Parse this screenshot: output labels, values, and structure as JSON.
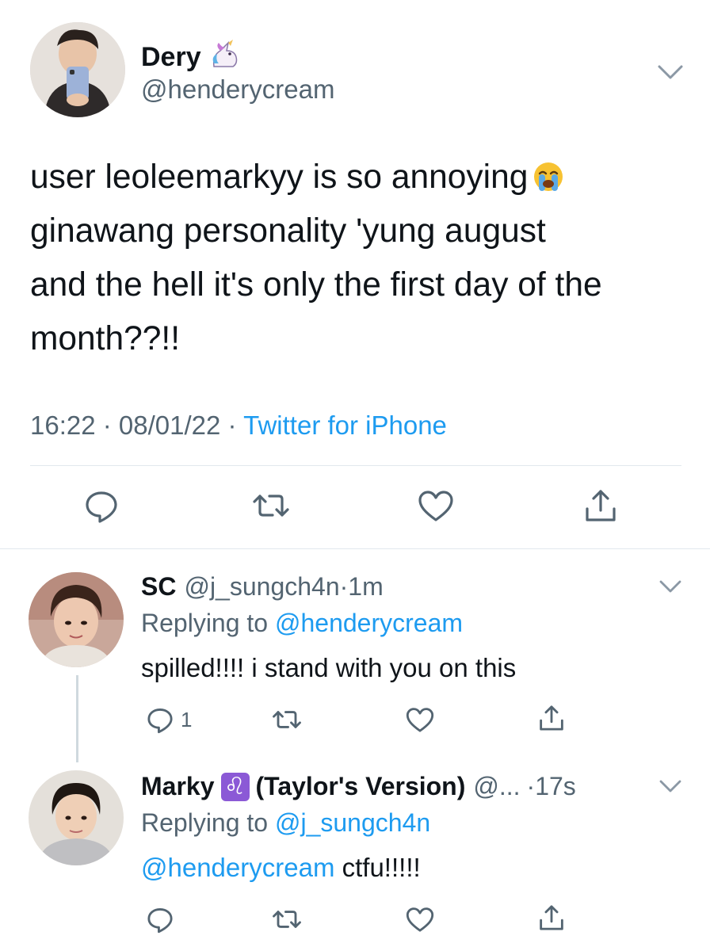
{
  "main_tweet": {
    "display_name": "Dery",
    "name_emoji": "unicorn-emoji",
    "handle": "@henderycream",
    "text_lines": [
      "user leoleemarkyy is so annoying",
      "ginawang personality 'yung august",
      "and the hell it's only the first day of the",
      "month??!!"
    ],
    "text_emoji": "loudly-crying-face-emoji",
    "time": "16:22",
    "date": "08/01/22",
    "source": "Twitter for iPhone",
    "actions": [
      "reply-icon",
      "retweet-icon",
      "like-icon",
      "share-icon"
    ]
  },
  "replies": [
    {
      "display_name": "SC",
      "handle": "@j_sungch4n",
      "time": "1m",
      "replying_prefix": "Replying to ",
      "replying_to": "@henderycream",
      "text": "spilled!!!! i stand with you on this",
      "reply_count": "1"
    },
    {
      "display_name": "Marky",
      "name_emoji": "♌",
      "name_suffix": "(Taylor's Version)",
      "handle": "@...",
      "time": "17s",
      "replying_prefix": "Replying to ",
      "replying_to": "@j_sungch4n",
      "mention": "@henderycream",
      "text": " ctfu!!!!!"
    }
  ],
  "colors": {
    "text": "#0f1419",
    "secondary": "#536471",
    "link": "#1d9bf0",
    "divider": "#e1e8ed"
  }
}
